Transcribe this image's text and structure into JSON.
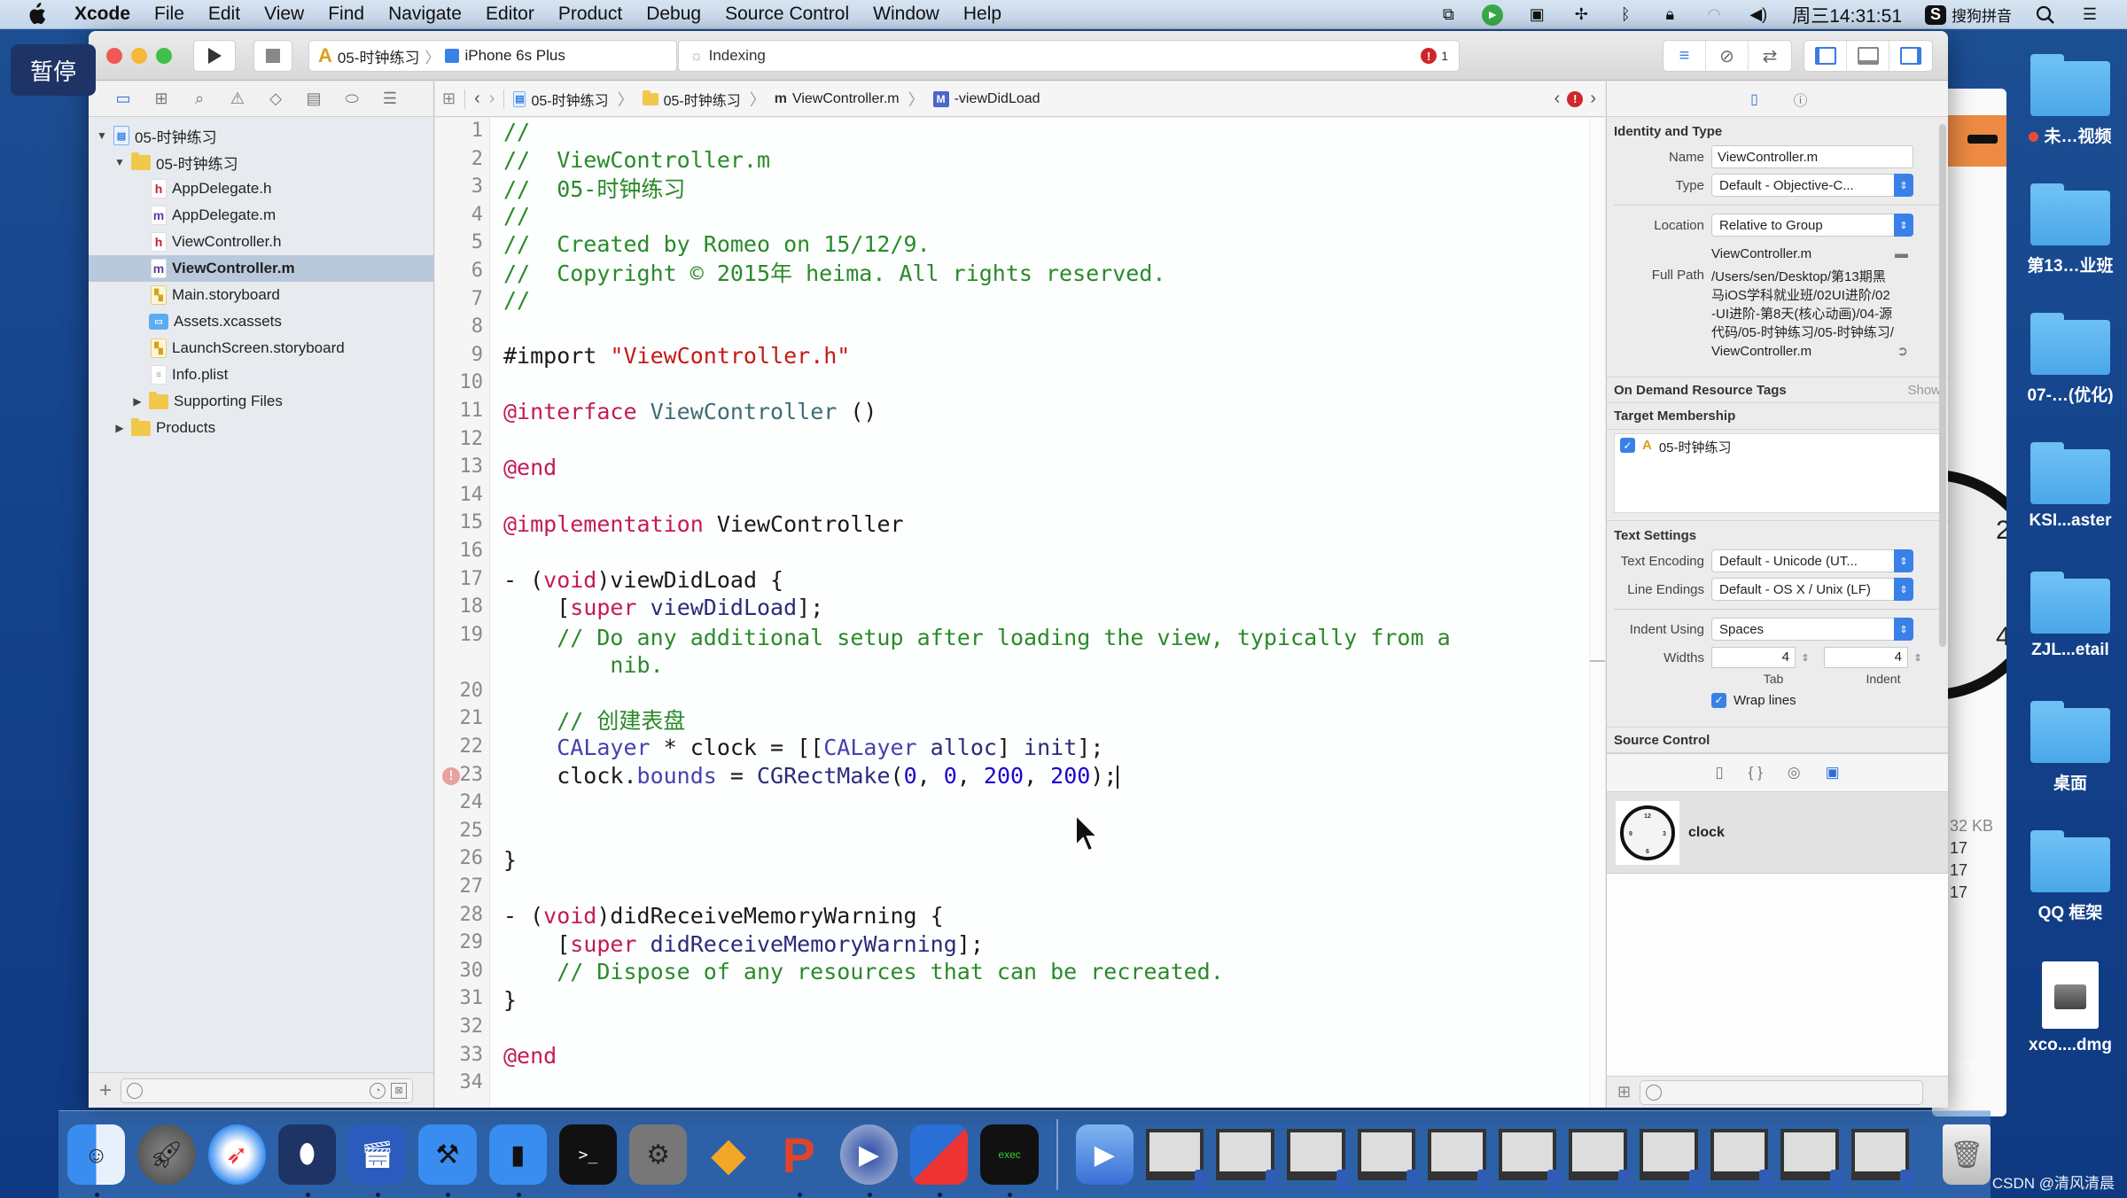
{
  "menubar": {
    "app_name": "Xcode",
    "items": [
      "File",
      "Edit",
      "View",
      "Find",
      "Navigate",
      "Editor",
      "Product",
      "Debug",
      "Source Control",
      "Window",
      "Help"
    ],
    "status_icons": [
      "window-copy-icon",
      "recorder-icon",
      "camera-icon",
      "network-icon",
      "bluetooth-icon",
      "lock-icon",
      "wifi-icon",
      "volume-icon"
    ],
    "clock": "周三14:31:51",
    "input_method": "搜狗拼音"
  },
  "overlay": {
    "pause_label": "暂停"
  },
  "toolbar": {
    "scheme": "05-时钟练习",
    "device": "iPhone 6s Plus",
    "activity_status": "Indexing",
    "error_count": "1"
  },
  "navigator": {
    "tree": [
      {
        "label": "05-时钟练习",
        "kind": "project",
        "level": 0,
        "expanded": true
      },
      {
        "label": "05-时钟练习",
        "kind": "folder",
        "level": 1,
        "expanded": true
      },
      {
        "label": "AppDelegate.h",
        "kind": "h",
        "level": 2
      },
      {
        "label": "AppDelegate.m",
        "kind": "m",
        "level": 2
      },
      {
        "label": "ViewController.h",
        "kind": "h",
        "level": 2
      },
      {
        "label": "ViewController.m",
        "kind": "m",
        "level": 2,
        "selected": true
      },
      {
        "label": "Main.storyboard",
        "kind": "storyboard",
        "level": 2
      },
      {
        "label": "Assets.xcassets",
        "kind": "assets",
        "level": 2
      },
      {
        "label": "LaunchScreen.storyboard",
        "kind": "storyboard",
        "level": 2
      },
      {
        "label": "Info.plist",
        "kind": "plist",
        "level": 2
      },
      {
        "label": "Supporting Files",
        "kind": "folder",
        "level": 2,
        "expanded": false
      },
      {
        "label": "Products",
        "kind": "folder",
        "level": 1,
        "expanded": false
      }
    ]
  },
  "jumpbar": {
    "crumbs": [
      "05-时钟练习",
      "05-时钟练习",
      "ViewController.m",
      "-viewDidLoad"
    ]
  },
  "editor": {
    "error_line": 23,
    "lines": [
      {
        "n": "1",
        "tokens": [
          [
            "c-com",
            "//"
          ]
        ]
      },
      {
        "n": "2",
        "tokens": [
          [
            "c-com",
            "//  ViewController.m"
          ]
        ]
      },
      {
        "n": "3",
        "tokens": [
          [
            "c-com",
            "//  05-时钟练习"
          ]
        ]
      },
      {
        "n": "4",
        "tokens": [
          [
            "c-com",
            "//"
          ]
        ]
      },
      {
        "n": "5",
        "tokens": [
          [
            "c-com",
            "//  Created by Romeo on 15/12/9."
          ]
        ]
      },
      {
        "n": "6",
        "tokens": [
          [
            "c-com",
            "//  Copyright © 2015年 heima. All rights reserved."
          ]
        ]
      },
      {
        "n": "7",
        "tokens": [
          [
            "c-com",
            "//"
          ]
        ]
      },
      {
        "n": "8",
        "tokens": []
      },
      {
        "n": "9",
        "tokens": [
          [
            "",
            "#import "
          ],
          [
            "c-str",
            "\"ViewController.h\""
          ]
        ]
      },
      {
        "n": "10",
        "tokens": []
      },
      {
        "n": "11",
        "tokens": [
          [
            "c-kw",
            "@interface"
          ],
          [
            "",
            " "
          ],
          [
            "c-cls",
            "ViewController"
          ],
          [
            "",
            " ()"
          ]
        ]
      },
      {
        "n": "12",
        "tokens": []
      },
      {
        "n": "13",
        "tokens": [
          [
            "c-kw",
            "@end"
          ]
        ]
      },
      {
        "n": "14",
        "tokens": []
      },
      {
        "n": "15",
        "tokens": [
          [
            "c-kw",
            "@implementation"
          ],
          [
            "",
            " ViewController"
          ]
        ]
      },
      {
        "n": "16",
        "tokens": []
      },
      {
        "n": "17",
        "tokens": [
          [
            "",
            "- ("
          ],
          [
            "c-kw",
            "void"
          ],
          [
            "",
            ")viewDidLoad {"
          ]
        ]
      },
      {
        "n": "18",
        "tokens": [
          [
            "",
            "    ["
          ],
          [
            "c-kw",
            "super"
          ],
          [
            "",
            " "
          ],
          [
            "c-meth",
            "viewDidLoad"
          ],
          [
            "",
            "];"
          ]
        ]
      },
      {
        "n": "19",
        "tokens": [
          [
            "c-com",
            "    // Do any additional setup after loading the view, typically from a\n        nib."
          ]
        ]
      },
      {
        "n": "20",
        "tokens": []
      },
      {
        "n": "21",
        "tokens": [
          [
            "c-com",
            "    // 创建表盘"
          ]
        ]
      },
      {
        "n": "22",
        "tokens": [
          [
            "",
            "    "
          ],
          [
            "c-type",
            "CALayer"
          ],
          [
            "",
            " * clock = [["
          ],
          [
            "c-type",
            "CALayer"
          ],
          [
            "",
            " "
          ],
          [
            "c-meth",
            "alloc"
          ],
          [
            "",
            "] "
          ],
          [
            "c-meth",
            "init"
          ],
          [
            "",
            "];"
          ]
        ]
      },
      {
        "n": "23",
        "tokens": [
          [
            "",
            "    clock."
          ],
          [
            "c-prop",
            "bounds"
          ],
          [
            "",
            " = "
          ],
          [
            "c-meth",
            "CGRectMake"
          ],
          [
            "",
            "("
          ],
          [
            "c-num",
            "0"
          ],
          [
            "",
            ", "
          ],
          [
            "c-num",
            "0"
          ],
          [
            "",
            ", "
          ],
          [
            "c-num",
            "200"
          ],
          [
            "",
            ", "
          ],
          [
            "c-num",
            "200"
          ],
          [
            "",
            ");"
          ]
        ]
      },
      {
        "n": "24",
        "tokens": []
      },
      {
        "n": "25",
        "tokens": []
      },
      {
        "n": "26",
        "tokens": [
          [
            "",
            "}"
          ]
        ]
      },
      {
        "n": "27",
        "tokens": []
      },
      {
        "n": "28",
        "tokens": [
          [
            "",
            "- ("
          ],
          [
            "c-kw",
            "void"
          ],
          [
            "",
            ")didReceiveMemoryWarning {"
          ]
        ]
      },
      {
        "n": "29",
        "tokens": [
          [
            "",
            "    ["
          ],
          [
            "c-kw",
            "super"
          ],
          [
            "",
            " "
          ],
          [
            "c-meth",
            "didReceiveMemoryWarning"
          ],
          [
            "",
            "];"
          ]
        ]
      },
      {
        "n": "30",
        "tokens": [
          [
            "c-com",
            "    // Dispose of any resources that can be recreated."
          ]
        ]
      },
      {
        "n": "31",
        "tokens": [
          [
            "",
            "}"
          ]
        ]
      },
      {
        "n": "32",
        "tokens": []
      },
      {
        "n": "33",
        "tokens": [
          [
            "c-kw",
            "@end"
          ]
        ]
      },
      {
        "n": "34",
        "tokens": []
      }
    ]
  },
  "inspector": {
    "identity": {
      "title": "Identity and Type",
      "name_label": "Name",
      "name_value": "ViewController.m",
      "type_label": "Type",
      "type_value": "Default - Objective-C...",
      "location_label": "Location",
      "location_value": "Relative to Group",
      "relative_file": "ViewController.m",
      "full_path_label": "Full Path",
      "full_path_value": "/Users/sen/Desktop/第13期黑马iOS学科就业班/02UI进阶/02-UI进阶-第8天(核心动画)/04-源代码/05-时钟练习/05-时钟练习/ViewController.m"
    },
    "on_demand": {
      "title": "On Demand Resource Tags",
      "action": "Show"
    },
    "membership": {
      "title": "Target Membership",
      "target": "05-时钟练习",
      "checked": true
    },
    "text_settings": {
      "title": "Text Settings",
      "encoding_label": "Text Encoding",
      "encoding_value": "Default - Unicode (UT...",
      "line_endings_label": "Line Endings",
      "line_endings_value": "Default - OS X / Unix (LF)",
      "indent_using_label": "Indent Using",
      "indent_using_value": "Spaces",
      "widths_label": "Widths",
      "tab_width": "4",
      "indent_width": "4",
      "tab_label": "Tab",
      "indent_label": "Indent",
      "wrap_lines_label": "Wrap lines",
      "wrap_lines_checked": true
    },
    "source_control": {
      "title": "Source Control"
    },
    "library": {
      "items": [
        {
          "label": "clock"
        }
      ]
    }
  },
  "background_window": {
    "size": "32 KB",
    "values": [
      "17",
      "17",
      "17"
    ],
    "copy_label": "opy"
  },
  "desktop": {
    "items": [
      {
        "label": "未…视频",
        "kind": "folder",
        "tag": true
      },
      {
        "label": "第13…业班",
        "kind": "folder"
      },
      {
        "label": "07-…(优化)",
        "kind": "folder"
      },
      {
        "label": "KSI...aster",
        "kind": "folder"
      },
      {
        "label": "ZJL...etail",
        "kind": "folder"
      },
      {
        "label": "桌面",
        "kind": "folder"
      },
      {
        "label": "QQ 框架",
        "kind": "folder"
      },
      {
        "label": "xco....dmg",
        "kind": "dmg"
      }
    ]
  },
  "dock": {
    "apps": [
      {
        "name": "finder",
        "running": true
      },
      {
        "name": "launchpad",
        "running": false
      },
      {
        "name": "safari",
        "running": false
      },
      {
        "name": "mouse-app",
        "running": true
      },
      {
        "name": "screen-recorder",
        "running": true
      },
      {
        "name": "xcode",
        "running": true
      },
      {
        "name": "simulator",
        "running": true
      },
      {
        "name": "terminal",
        "running": false
      },
      {
        "name": "system-preferences",
        "running": false
      },
      {
        "name": "sketch",
        "running": false
      },
      {
        "name": "paw",
        "running": true
      },
      {
        "name": "quicktime-player",
        "running": true
      },
      {
        "name": "parallels",
        "running": true
      },
      {
        "name": "console",
        "running": true
      }
    ],
    "documents_count": 11,
    "watermark": "CSDN @清风清晨"
  }
}
